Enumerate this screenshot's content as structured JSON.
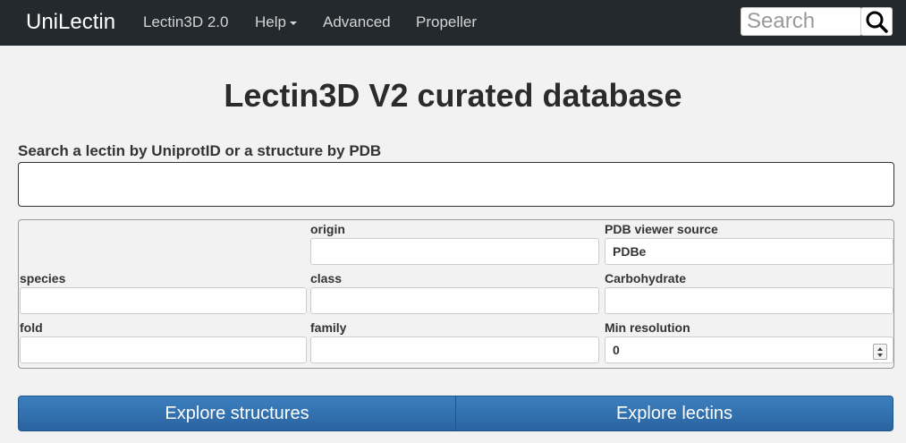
{
  "navbar": {
    "brand": "UniLectin",
    "items": [
      {
        "label": "Lectin3D 2.0"
      },
      {
        "label": "Help"
      },
      {
        "label": "Advanced"
      },
      {
        "label": "Propeller"
      }
    ],
    "search_placeholder": "Search",
    "search_icon": "search-icon"
  },
  "main": {
    "title": "Lectin3D V2 curated database",
    "search_label": "Search a lectin by UniprotID or a structure by PDB",
    "search_value": ""
  },
  "filters": {
    "origin": {
      "label": "origin",
      "value": ""
    },
    "pdb_viewer": {
      "label": "PDB viewer source",
      "value": "PDBe"
    },
    "species": {
      "label": "species",
      "value": ""
    },
    "class": {
      "label": "class",
      "value": ""
    },
    "carbohydrate": {
      "label": "Carbohydrate",
      "value": ""
    },
    "fold": {
      "label": "fold",
      "value": ""
    },
    "family": {
      "label": "family",
      "value": ""
    },
    "min_resolution": {
      "label": "Min resolution",
      "value": "0"
    }
  },
  "actions": {
    "explore_structures": "Explore structures",
    "explore_lectins": "Explore lectins"
  },
  "colors": {
    "navbar": "#24292e",
    "button": "#2f6fad",
    "background": "#f2f2f2"
  }
}
